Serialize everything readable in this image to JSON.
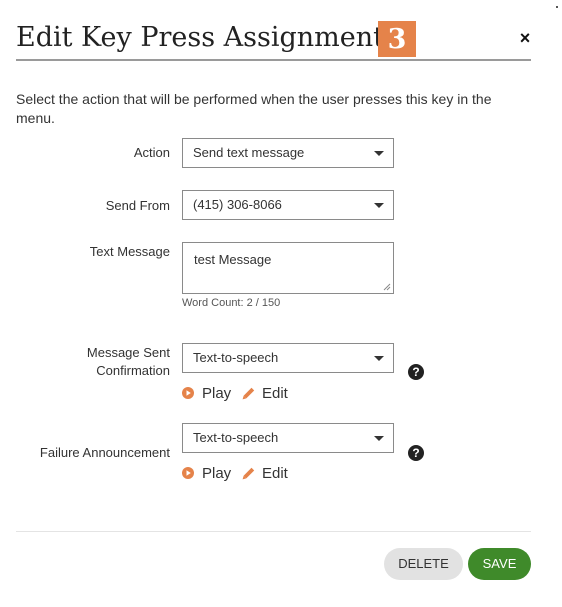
{
  "dialog": {
    "title": "Edit Key Press Assignment -",
    "key_number": "3",
    "close_label": "×",
    "description": "Select the action that will be performed when the user presses this key in the menu."
  },
  "form": {
    "action": {
      "label": "Action",
      "value": "Send text message"
    },
    "send_from": {
      "label": "Send From",
      "value": "(415) 306-8066"
    },
    "text_message": {
      "label": "Text Message",
      "value": "test Message",
      "word_count": "Word Count: 2 / 150"
    },
    "message_sent_confirmation": {
      "label": "Message Sent Confirmation",
      "value": "Text-to-speech",
      "help": "?",
      "play_label": "Play",
      "edit_label": "Edit"
    },
    "failure_announcement": {
      "label": "Failure Announcement",
      "value": "Text-to-speech",
      "help": "?",
      "play_label": "Play",
      "edit_label": "Edit"
    }
  },
  "footer": {
    "delete_label": "DELETE",
    "save_label": "SAVE"
  },
  "colors": {
    "badge": "#e5834a",
    "accent_orange": "#e5834a",
    "save_green": "#3f8a2a",
    "delete_gray": "#e2e2e2"
  },
  "icons": {
    "close": "close-icon",
    "help": "question-circle-icon",
    "play": "play-circle-icon",
    "edit": "pencil-icon",
    "dropdown": "caret-down-icon"
  }
}
